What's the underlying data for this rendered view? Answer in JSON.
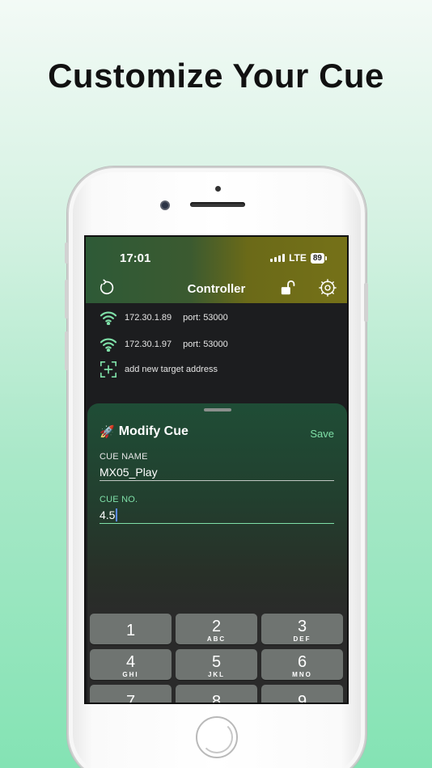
{
  "headline": "Customize Your Cue",
  "status": {
    "time": "17:01",
    "network": "LTE",
    "battery": "89"
  },
  "nav": {
    "title": "Controller"
  },
  "targets": [
    {
      "ip": "172.30.1.89",
      "port": "port: 53000"
    },
    {
      "ip": "172.30.1.97",
      "port": "port: 53000"
    }
  ],
  "add_target_label": "add new target address",
  "sheet": {
    "icon": "🚀",
    "title": "Modify Cue",
    "save_label": "Save",
    "cue_name_label": "CUE NAME",
    "cue_name_value": "MX05_Play",
    "cue_no_label": "CUE NO.",
    "cue_no_value": "4.5"
  },
  "keypad": [
    {
      "num": "1",
      "letters": ""
    },
    {
      "num": "2",
      "letters": "ABC"
    },
    {
      "num": "3",
      "letters": "DEF"
    },
    {
      "num": "4",
      "letters": "GHI"
    },
    {
      "num": "5",
      "letters": "JKL"
    },
    {
      "num": "6",
      "letters": "MNO"
    },
    {
      "num": "7",
      "letters": ""
    },
    {
      "num": "8",
      "letters": ""
    },
    {
      "num": "9",
      "letters": ""
    }
  ],
  "colors": {
    "accent": "#7fe0a8",
    "background_top": "#f3faf6",
    "background_bottom": "#84e3b4"
  }
}
